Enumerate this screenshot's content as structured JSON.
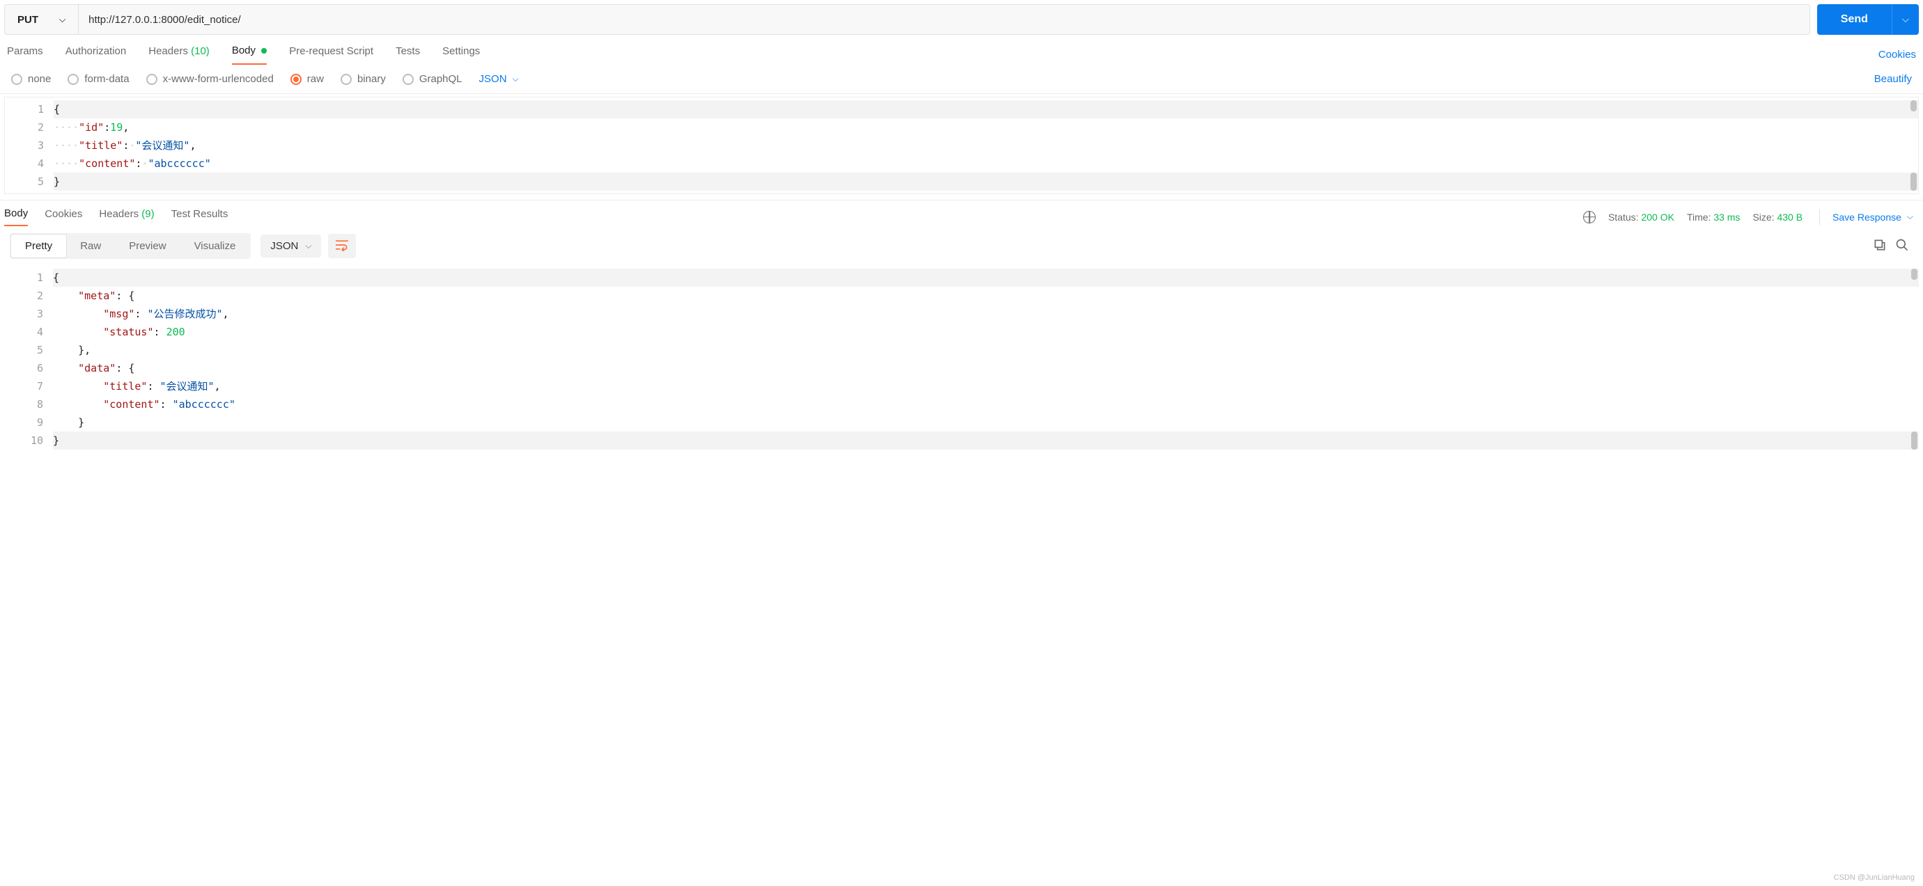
{
  "request": {
    "method": "PUT",
    "url": "http://127.0.0.1:8000/edit_notice/",
    "send_label": "Send"
  },
  "tabs": {
    "params": "Params",
    "auth": "Authorization",
    "headers_label": "Headers",
    "headers_count": "(10)",
    "body": "Body",
    "prerequest": "Pre-request Script",
    "tests": "Tests",
    "settings": "Settings",
    "cookies_link": "Cookies"
  },
  "body_type": {
    "none": "none",
    "formdata": "form-data",
    "urlencoded": "x-www-form-urlencoded",
    "raw": "raw",
    "binary": "binary",
    "graphql": "GraphQL",
    "lang": "JSON",
    "beautify": "Beautify"
  },
  "request_body_lines": [
    "1",
    "2",
    "3",
    "4",
    "5"
  ],
  "request_body": {
    "id_key": "\"id\"",
    "id_val": "19",
    "title_key": "\"title\"",
    "title_val": "\"会议通知\"",
    "content_key": "\"content\"",
    "content_val": "\"abcccccc\""
  },
  "response_tabs": {
    "body": "Body",
    "cookies": "Cookies",
    "headers_label": "Headers",
    "headers_count": "(9)",
    "test_results": "Test Results"
  },
  "response_meta": {
    "status_label": "Status:",
    "status_value": "200 OK",
    "time_label": "Time:",
    "time_value": "33 ms",
    "size_label": "Size:",
    "size_value": "430 B",
    "save_label": "Save Response"
  },
  "response_toolbar": {
    "pretty": "Pretty",
    "raw": "Raw",
    "preview": "Preview",
    "visualize": "Visualize",
    "lang": "JSON"
  },
  "response_body_lines": [
    "1",
    "2",
    "3",
    "4",
    "5",
    "6",
    "7",
    "8",
    "9",
    "10"
  ],
  "response_body": {
    "meta_key": "\"meta\"",
    "msg_key": "\"msg\"",
    "msg_val": "\"公告修改成功\"",
    "status_key": "\"status\"",
    "status_val": "200",
    "data_key": "\"data\"",
    "title_key": "\"title\"",
    "title_val": "\"会议通知\"",
    "content_key": "\"content\"",
    "content_val": "\"abcccccc\""
  },
  "watermark": "CSDN @JunLianHuang"
}
